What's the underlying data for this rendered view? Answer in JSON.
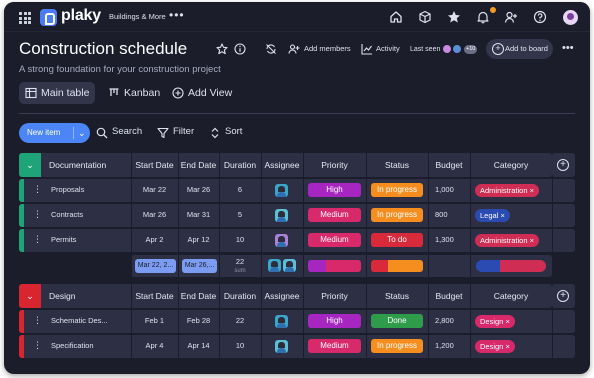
{
  "topbar": {
    "logo": "plaky",
    "workspace": "Buildings & More",
    "more": "•••"
  },
  "header": {
    "title": "Construction schedule",
    "subtitle": "A strong foundation for your construction project",
    "add_members": "Add members",
    "activity": "Activity",
    "last_seen": "Last seen",
    "last_seen_count": "+10",
    "add_to_board": "Add to board",
    "more": "•••"
  },
  "views": [
    {
      "label": "Main table",
      "icon": "table-icon"
    },
    {
      "label": "Kanban",
      "icon": "kanban-icon"
    },
    {
      "label": "Add View",
      "icon": "plus-circle-icon"
    }
  ],
  "toolbar": {
    "new_item": "New item",
    "search": "Search",
    "filter": "Filter",
    "sort": "Sort"
  },
  "columns": [
    "Start Date",
    "End Date",
    "Duration",
    "Assignee",
    "Priority",
    "Status",
    "Budget",
    "Category"
  ],
  "groups": [
    {
      "name": "Documentation",
      "color": "#1fa47a",
      "rows": [
        {
          "name": "Proposals",
          "start": "Mar 22",
          "end": "Mar 26",
          "duration": "6",
          "priority": "High",
          "priority_color": "#a726c1",
          "status": "In progress",
          "status_color": "#f58d1f",
          "budget": "1,000",
          "category": [
            {
              "label": "Administration",
              "color": "#d02d54"
            }
          ]
        },
        {
          "name": "Contracts",
          "start": "Mar 26",
          "end": "Mar 31",
          "duration": "5",
          "priority": "Medium",
          "priority_color": "#d8296a",
          "status": "In progress",
          "status_color": "#f58d1f",
          "budget": "800",
          "category": [
            {
              "label": "Legal",
              "color": "#2a4cb2"
            }
          ]
        },
        {
          "name": "Permits",
          "start": "Apr 2",
          "end": "Apr 12",
          "duration": "10",
          "priority": "Medium",
          "priority_color": "#d8296a",
          "status": "To do",
          "status_color": "#d82a3a",
          "budget": "1,300",
          "category": [
            {
              "label": "Administration",
              "color": "#d02d54"
            }
          ]
        }
      ],
      "summary": {
        "start": "Mar 22, 2...",
        "end": "Mar 26,...",
        "duration": "22",
        "duration_label": "sum"
      }
    },
    {
      "name": "Design",
      "color": "#d92530",
      "rows": [
        {
          "name": "Schematic Des...",
          "start": "Feb 1",
          "end": "Feb 28",
          "duration": "22",
          "priority": "High",
          "priority_color": "#a726c1",
          "status": "Done",
          "status_color": "#2e9c4a",
          "budget": "2,800",
          "category": [
            {
              "label": "Design",
              "color": "#d8296a"
            }
          ]
        },
        {
          "name": "Specification",
          "start": "Apr 4",
          "end": "Apr 14",
          "duration": "10",
          "priority": "Medium",
          "priority_color": "#d8296a",
          "status": "In progress",
          "status_color": "#f58d1f",
          "budget": "1,200",
          "category": [
            {
              "label": "Design",
              "color": "#d8296a"
            }
          ]
        }
      ]
    }
  ]
}
